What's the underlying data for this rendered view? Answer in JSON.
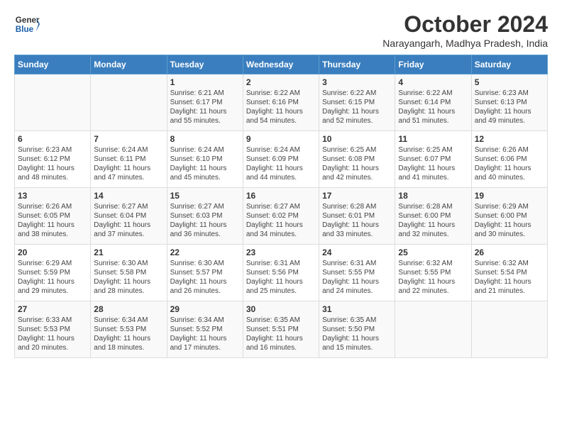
{
  "header": {
    "logo_line1": "General",
    "logo_line2": "Blue",
    "month": "October 2024",
    "location": "Narayangarh, Madhya Pradesh, India"
  },
  "days_of_week": [
    "Sunday",
    "Monday",
    "Tuesday",
    "Wednesday",
    "Thursday",
    "Friday",
    "Saturday"
  ],
  "weeks": [
    [
      {
        "day": "",
        "info": ""
      },
      {
        "day": "",
        "info": ""
      },
      {
        "day": "1",
        "info": "Sunrise: 6:21 AM\nSunset: 6:17 PM\nDaylight: 11 hours and 55 minutes."
      },
      {
        "day": "2",
        "info": "Sunrise: 6:22 AM\nSunset: 6:16 PM\nDaylight: 11 hours and 54 minutes."
      },
      {
        "day": "3",
        "info": "Sunrise: 6:22 AM\nSunset: 6:15 PM\nDaylight: 11 hours and 52 minutes."
      },
      {
        "day": "4",
        "info": "Sunrise: 6:22 AM\nSunset: 6:14 PM\nDaylight: 11 hours and 51 minutes."
      },
      {
        "day": "5",
        "info": "Sunrise: 6:23 AM\nSunset: 6:13 PM\nDaylight: 11 hours and 49 minutes."
      }
    ],
    [
      {
        "day": "6",
        "info": "Sunrise: 6:23 AM\nSunset: 6:12 PM\nDaylight: 11 hours and 48 minutes."
      },
      {
        "day": "7",
        "info": "Sunrise: 6:24 AM\nSunset: 6:11 PM\nDaylight: 11 hours and 47 minutes."
      },
      {
        "day": "8",
        "info": "Sunrise: 6:24 AM\nSunset: 6:10 PM\nDaylight: 11 hours and 45 minutes."
      },
      {
        "day": "9",
        "info": "Sunrise: 6:24 AM\nSunset: 6:09 PM\nDaylight: 11 hours and 44 minutes."
      },
      {
        "day": "10",
        "info": "Sunrise: 6:25 AM\nSunset: 6:08 PM\nDaylight: 11 hours and 42 minutes."
      },
      {
        "day": "11",
        "info": "Sunrise: 6:25 AM\nSunset: 6:07 PM\nDaylight: 11 hours and 41 minutes."
      },
      {
        "day": "12",
        "info": "Sunrise: 6:26 AM\nSunset: 6:06 PM\nDaylight: 11 hours and 40 minutes."
      }
    ],
    [
      {
        "day": "13",
        "info": "Sunrise: 6:26 AM\nSunset: 6:05 PM\nDaylight: 11 hours and 38 minutes."
      },
      {
        "day": "14",
        "info": "Sunrise: 6:27 AM\nSunset: 6:04 PM\nDaylight: 11 hours and 37 minutes."
      },
      {
        "day": "15",
        "info": "Sunrise: 6:27 AM\nSunset: 6:03 PM\nDaylight: 11 hours and 36 minutes."
      },
      {
        "day": "16",
        "info": "Sunrise: 6:27 AM\nSunset: 6:02 PM\nDaylight: 11 hours and 34 minutes."
      },
      {
        "day": "17",
        "info": "Sunrise: 6:28 AM\nSunset: 6:01 PM\nDaylight: 11 hours and 33 minutes."
      },
      {
        "day": "18",
        "info": "Sunrise: 6:28 AM\nSunset: 6:00 PM\nDaylight: 11 hours and 32 minutes."
      },
      {
        "day": "19",
        "info": "Sunrise: 6:29 AM\nSunset: 6:00 PM\nDaylight: 11 hours and 30 minutes."
      }
    ],
    [
      {
        "day": "20",
        "info": "Sunrise: 6:29 AM\nSunset: 5:59 PM\nDaylight: 11 hours and 29 minutes."
      },
      {
        "day": "21",
        "info": "Sunrise: 6:30 AM\nSunset: 5:58 PM\nDaylight: 11 hours and 28 minutes."
      },
      {
        "day": "22",
        "info": "Sunrise: 6:30 AM\nSunset: 5:57 PM\nDaylight: 11 hours and 26 minutes."
      },
      {
        "day": "23",
        "info": "Sunrise: 6:31 AM\nSunset: 5:56 PM\nDaylight: 11 hours and 25 minutes."
      },
      {
        "day": "24",
        "info": "Sunrise: 6:31 AM\nSunset: 5:55 PM\nDaylight: 11 hours and 24 minutes."
      },
      {
        "day": "25",
        "info": "Sunrise: 6:32 AM\nSunset: 5:55 PM\nDaylight: 11 hours and 22 minutes."
      },
      {
        "day": "26",
        "info": "Sunrise: 6:32 AM\nSunset: 5:54 PM\nDaylight: 11 hours and 21 minutes."
      }
    ],
    [
      {
        "day": "27",
        "info": "Sunrise: 6:33 AM\nSunset: 5:53 PM\nDaylight: 11 hours and 20 minutes."
      },
      {
        "day": "28",
        "info": "Sunrise: 6:34 AM\nSunset: 5:53 PM\nDaylight: 11 hours and 18 minutes."
      },
      {
        "day": "29",
        "info": "Sunrise: 6:34 AM\nSunset: 5:52 PM\nDaylight: 11 hours and 17 minutes."
      },
      {
        "day": "30",
        "info": "Sunrise: 6:35 AM\nSunset: 5:51 PM\nDaylight: 11 hours and 16 minutes."
      },
      {
        "day": "31",
        "info": "Sunrise: 6:35 AM\nSunset: 5:50 PM\nDaylight: 11 hours and 15 minutes."
      },
      {
        "day": "",
        "info": ""
      },
      {
        "day": "",
        "info": ""
      }
    ]
  ]
}
